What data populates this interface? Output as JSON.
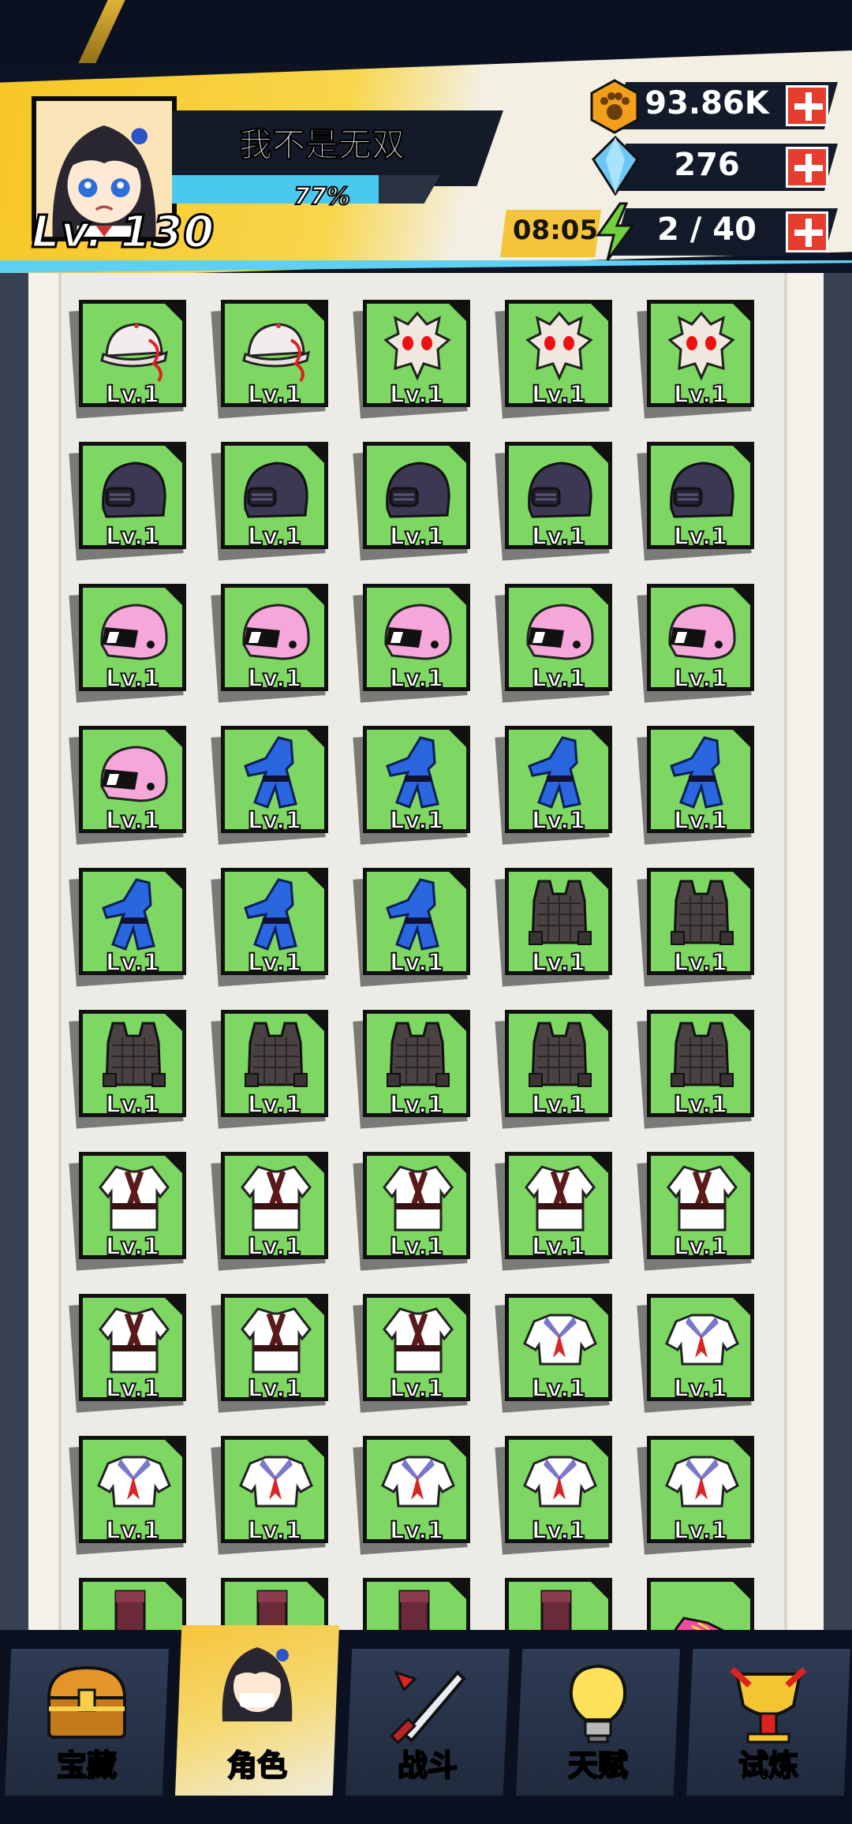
{
  "player": {
    "name": "我不是无双",
    "level": "Lv. 130",
    "exp_text": "77%",
    "exp_fraction": 0.77
  },
  "resources": {
    "coins": "93.86K",
    "gems": "276",
    "energy": "2 / 40",
    "energy_timer": "08:05"
  },
  "inventory": {
    "level_text": "Lv.1",
    "rows": [
      [
        "cap",
        "cap",
        "mask",
        "mask",
        "mask"
      ],
      [
        "helmet",
        "helmet",
        "helmet",
        "helmet",
        "helmet"
      ],
      [
        "pink-helmet",
        "pink-helmet",
        "pink-helmet",
        "pink-helmet",
        "pink-helmet"
      ],
      [
        "pink-helmet",
        "blue-robe",
        "blue-robe",
        "blue-robe",
        "blue-robe"
      ],
      [
        "blue-robe",
        "blue-robe",
        "blue-robe",
        "vest",
        "vest"
      ],
      [
        "vest",
        "vest",
        "vest",
        "vest",
        "vest"
      ],
      [
        "karate-gi",
        "karate-gi",
        "karate-gi",
        "karate-gi",
        "karate-gi"
      ],
      [
        "karate-gi",
        "karate-gi",
        "karate-gi",
        "sailor-shirt",
        "sailor-shirt"
      ],
      [
        "sailor-shirt",
        "sailor-shirt",
        "sailor-shirt",
        "sailor-shirt",
        "sailor-shirt"
      ],
      [
        "boots",
        "boots",
        "boots",
        "boots",
        "sneaker"
      ]
    ]
  },
  "nav": [
    {
      "label": "宝藏",
      "icon": "treasure-chest-icon",
      "active": false
    },
    {
      "label": "角色",
      "icon": "character-icon",
      "active": true
    },
    {
      "label": "战斗",
      "icon": "sword-icon",
      "active": false
    },
    {
      "label": "天赋",
      "icon": "lightbulb-icon",
      "active": false
    },
    {
      "label": "试炼",
      "icon": "trophy-icon",
      "active": false
    }
  ],
  "colors": {
    "slot_green": "#7dd762",
    "header_yellow": "#f7c625",
    "exp_blue": "#49c9ef",
    "plus_red": "#e63d2f"
  }
}
